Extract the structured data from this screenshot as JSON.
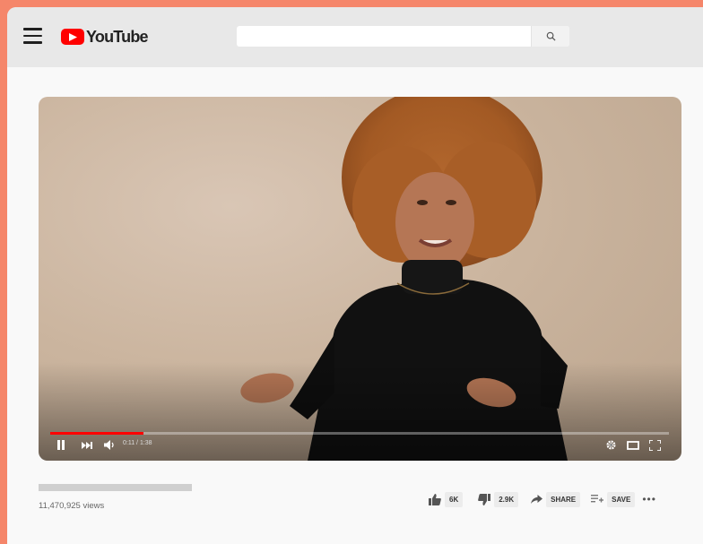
{
  "app": {
    "logo_text": "YouTube"
  },
  "search": {
    "placeholder": "",
    "value": ""
  },
  "player": {
    "current_time": "0:11",
    "duration": "1:38",
    "time_display": "0:11 / 1:38",
    "progress_fraction": 0.15,
    "state": "playing"
  },
  "video": {
    "views": "11,470,925 views"
  },
  "actions": {
    "like_count": "6K",
    "dislike_count": "2.9K",
    "share_label": "SHARE",
    "save_label": "SAVE"
  },
  "colors": {
    "brand_red": "#ff0000",
    "frame_background": "#f5866a",
    "topbar": "#e8e8e8",
    "page": "#f9f9f9"
  },
  "icons": [
    "menu-icon",
    "youtube-logo-icon",
    "search-icon",
    "pause-icon",
    "next-icon",
    "volume-icon",
    "settings-icon",
    "theater-mode-icon",
    "fullscreen-icon",
    "thumbs-up-icon",
    "thumbs-down-icon",
    "share-icon",
    "add-to-playlist-icon",
    "more-options-icon"
  ]
}
